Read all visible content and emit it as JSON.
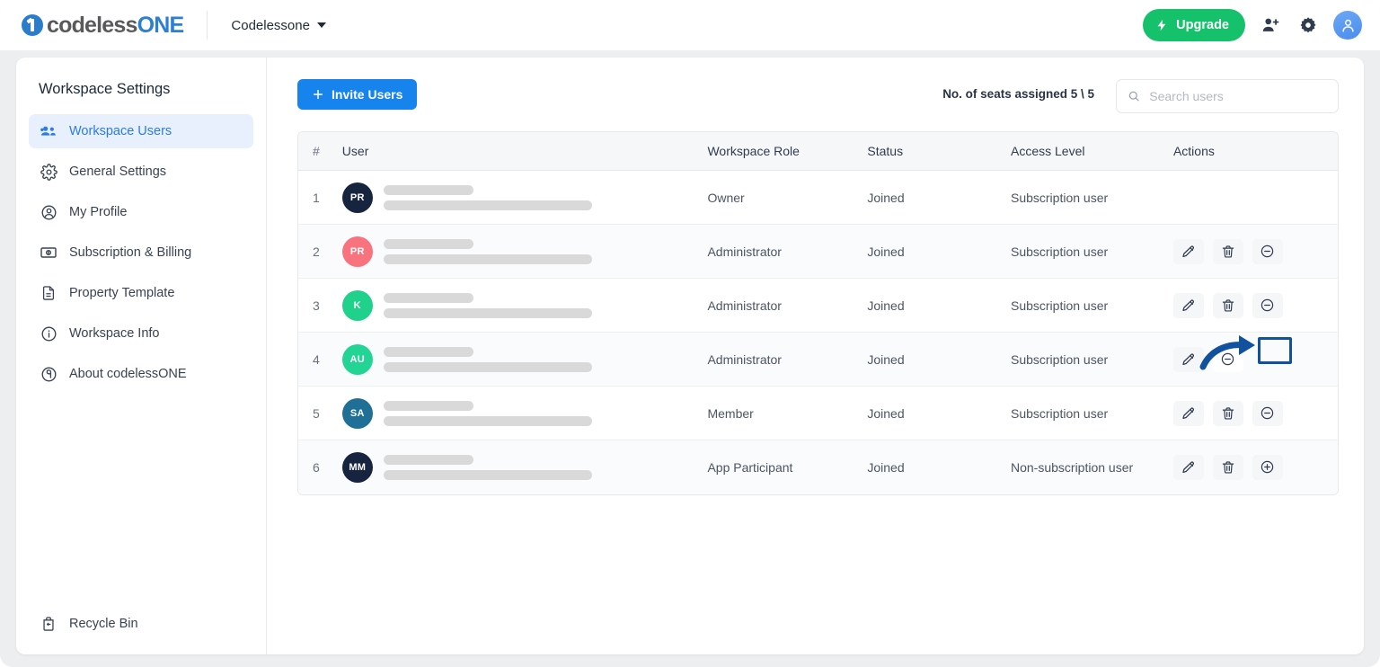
{
  "topbar": {
    "logo_first": "codeless",
    "logo_second": "ONE",
    "logo_icon": "codelessone-logo-icon",
    "workspace_name": "Codelessone",
    "upgrade_label": "Upgrade",
    "upgrade_icon": "lightning-bolt-icon",
    "upgrade_color": "#16c16c",
    "invite_user_icon": "user-plus-icon",
    "settings_icon": "gear-icon",
    "avatar_icon": "user-avatar-icon"
  },
  "sidebar": {
    "title": "Workspace Settings",
    "items": [
      {
        "label": "Workspace Users",
        "icon": "users-group-icon",
        "active": true
      },
      {
        "label": "General Settings",
        "icon": "gear-icon",
        "active": false
      },
      {
        "label": "My Profile",
        "icon": "user-circle-icon",
        "active": false
      },
      {
        "label": "Subscription & Billing",
        "icon": "banknote-icon",
        "active": false
      },
      {
        "label": "Property Template",
        "icon": "document-icon",
        "active": false
      },
      {
        "label": "Workspace Info",
        "icon": "info-circle-icon",
        "active": false
      },
      {
        "label": "About codelessONE",
        "icon": "about-icon",
        "active": false
      }
    ],
    "recycle_bin": {
      "label": "Recycle Bin",
      "icon": "recycle-bin-icon"
    },
    "active_color": "#2c7be5",
    "active_bg": "#e8f0fe"
  },
  "toolbar": {
    "invite_label": "Invite Users",
    "invite_icon": "plus-icon",
    "invite_color": "#1783ec",
    "seats_text": "No. of seats assigned 5 \\ 5",
    "search_placeholder": "Search users",
    "search_value": "",
    "search_icon": "search-icon"
  },
  "table": {
    "columns": [
      "#",
      "User",
      "Workspace Role",
      "Status",
      "Access Level",
      "Actions"
    ],
    "rows": [
      {
        "num": "1",
        "initials": "PR",
        "avatar_color": "#17243f",
        "role": "Owner",
        "status": "Joined",
        "access": "Subscription user",
        "actions": []
      },
      {
        "num": "2",
        "initials": "PR",
        "avatar_color": "#f9737f",
        "role": "Administrator",
        "status": "Joined",
        "access": "Subscription user",
        "actions": [
          "edit-icon",
          "delete-icon",
          "minus-circle-icon"
        ]
      },
      {
        "num": "3",
        "initials": "K",
        "avatar_color": "#1fd18b",
        "role": "Administrator",
        "status": "Joined",
        "access": "Subscription user",
        "actions": [
          "edit-icon",
          "delete-icon",
          "minus-circle-icon"
        ]
      },
      {
        "num": "4",
        "initials": "AU",
        "avatar_color": "#24d494",
        "role": "Administrator",
        "status": "Joined",
        "access": "Subscription user",
        "actions": [
          "edit-icon",
          "minus-circle-icon"
        ],
        "highlighted": true
      },
      {
        "num": "5",
        "initials": "SA",
        "avatar_color": "#1f6f96",
        "role": "Member",
        "status": "Joined",
        "access": "Subscription user",
        "actions": [
          "edit-icon",
          "delete-icon",
          "minus-circle-icon"
        ]
      },
      {
        "num": "6",
        "initials": "MM",
        "avatar_color": "#17243f",
        "role": "App Participant",
        "status": "Joined",
        "access": "Non-subscription user",
        "actions": [
          "edit-icon",
          "delete-icon",
          "plus-circle-icon"
        ]
      }
    ]
  },
  "annotation": {
    "type": "arrow-and-box",
    "color": "#12519e",
    "target": "row-4-remove-from-subscription-button"
  }
}
